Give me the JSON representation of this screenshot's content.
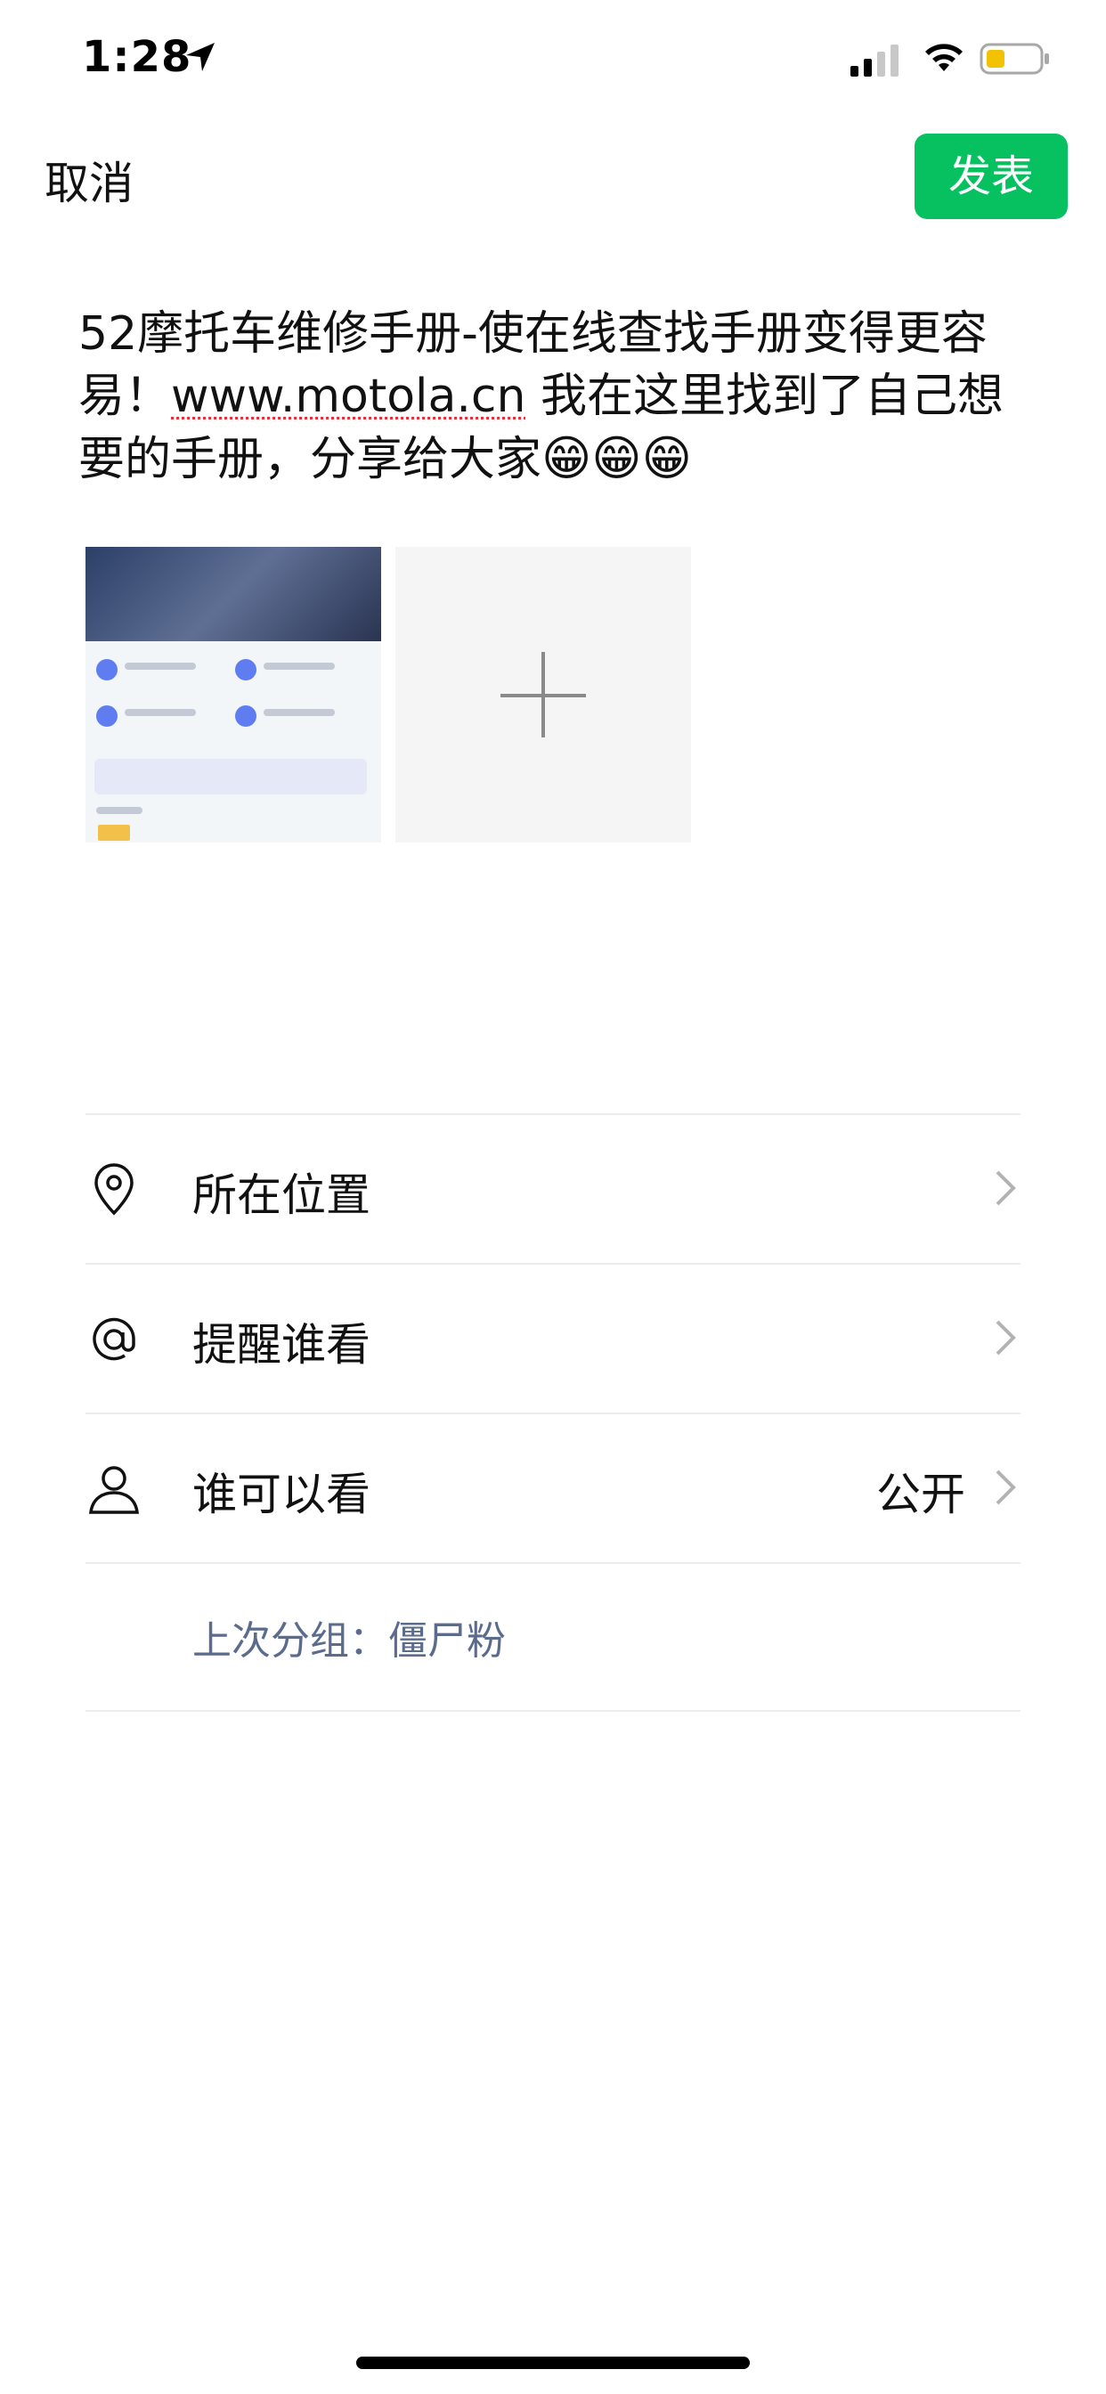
{
  "status_bar": {
    "time": "1:28",
    "battery_color": "#f2c200"
  },
  "header": {
    "cancel_label": "取消",
    "post_label": "发表",
    "post_color": "#07c160"
  },
  "post": {
    "text_before_link": "52摩托车维修手册-使在线查找手册变得更容易！",
    "link": "www.motola.cn",
    "text_after_link": " 我在这里找到了自己想要的手册，分享给大家",
    "emoji": "😁😁😁"
  },
  "media": {
    "image_icon": "screenshot-thumbnail",
    "add_icon": "plus-icon"
  },
  "options": {
    "location": {
      "label": "所在位置",
      "icon": "location-icon"
    },
    "remind": {
      "label": "提醒谁看",
      "icon": "at-icon"
    },
    "visibility": {
      "label": "谁可以看",
      "value": "公开",
      "icon": "user-icon"
    },
    "last_group": "上次分组：僵尸粉"
  }
}
